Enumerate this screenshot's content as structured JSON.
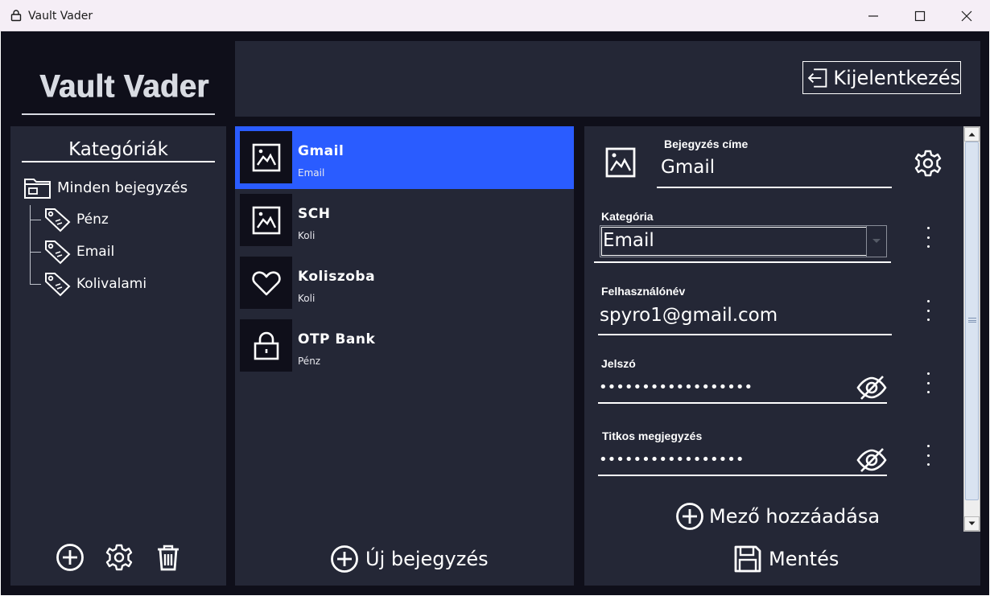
{
  "window": {
    "title": "Vault Vader",
    "controls": [
      "minimize-icon",
      "maximize-icon",
      "close-icon"
    ]
  },
  "app": {
    "logo": "Vault Vader",
    "logout_label": "Kijelentkezés"
  },
  "sidebar": {
    "title": "Kategóriák",
    "root": {
      "label": "Minden bejegyzés",
      "icon": "folder-icon"
    },
    "categories": [
      {
        "label": "Pénz",
        "icon": "tag-icon"
      },
      {
        "label": "Email",
        "icon": "tag-icon"
      },
      {
        "label": "Kolivalami",
        "icon": "tag-icon"
      }
    ],
    "actions": [
      "add-category-icon",
      "category-settings-icon",
      "delete-category-icon"
    ]
  },
  "entries": {
    "items": [
      {
        "name": "Gmail",
        "category": "Email",
        "icon": "image-icon",
        "selected": true
      },
      {
        "name": "SCH",
        "category": "Koli",
        "icon": "image-icon",
        "selected": false
      },
      {
        "name": "Koliszoba",
        "category": "Koli",
        "icon": "heart-icon",
        "selected": false
      },
      {
        "name": "OTP Bank",
        "category": "Pénz",
        "icon": "lock-icon",
        "selected": false
      }
    ],
    "new_entry_label": "Új bejegyzés"
  },
  "details": {
    "title_label": "Bejegyzés címe",
    "title_value": "Gmail",
    "category_label": "Kategória",
    "category_value": "Email",
    "username_label": "Felhasználónév",
    "username_value": "spyro1@gmail.com",
    "password_label": "Jelszó",
    "password_value": "••••••••••••••••••",
    "note_label": "Titkos megjegyzés",
    "note_value": "•••••••••••••••••",
    "add_field_label": "Mező hozzáadása",
    "save_label": "Mentés"
  },
  "colors": {
    "background": "#0f0f1a",
    "panel": "#242736",
    "accent": "#2a5cff",
    "text": "#ffffff"
  }
}
